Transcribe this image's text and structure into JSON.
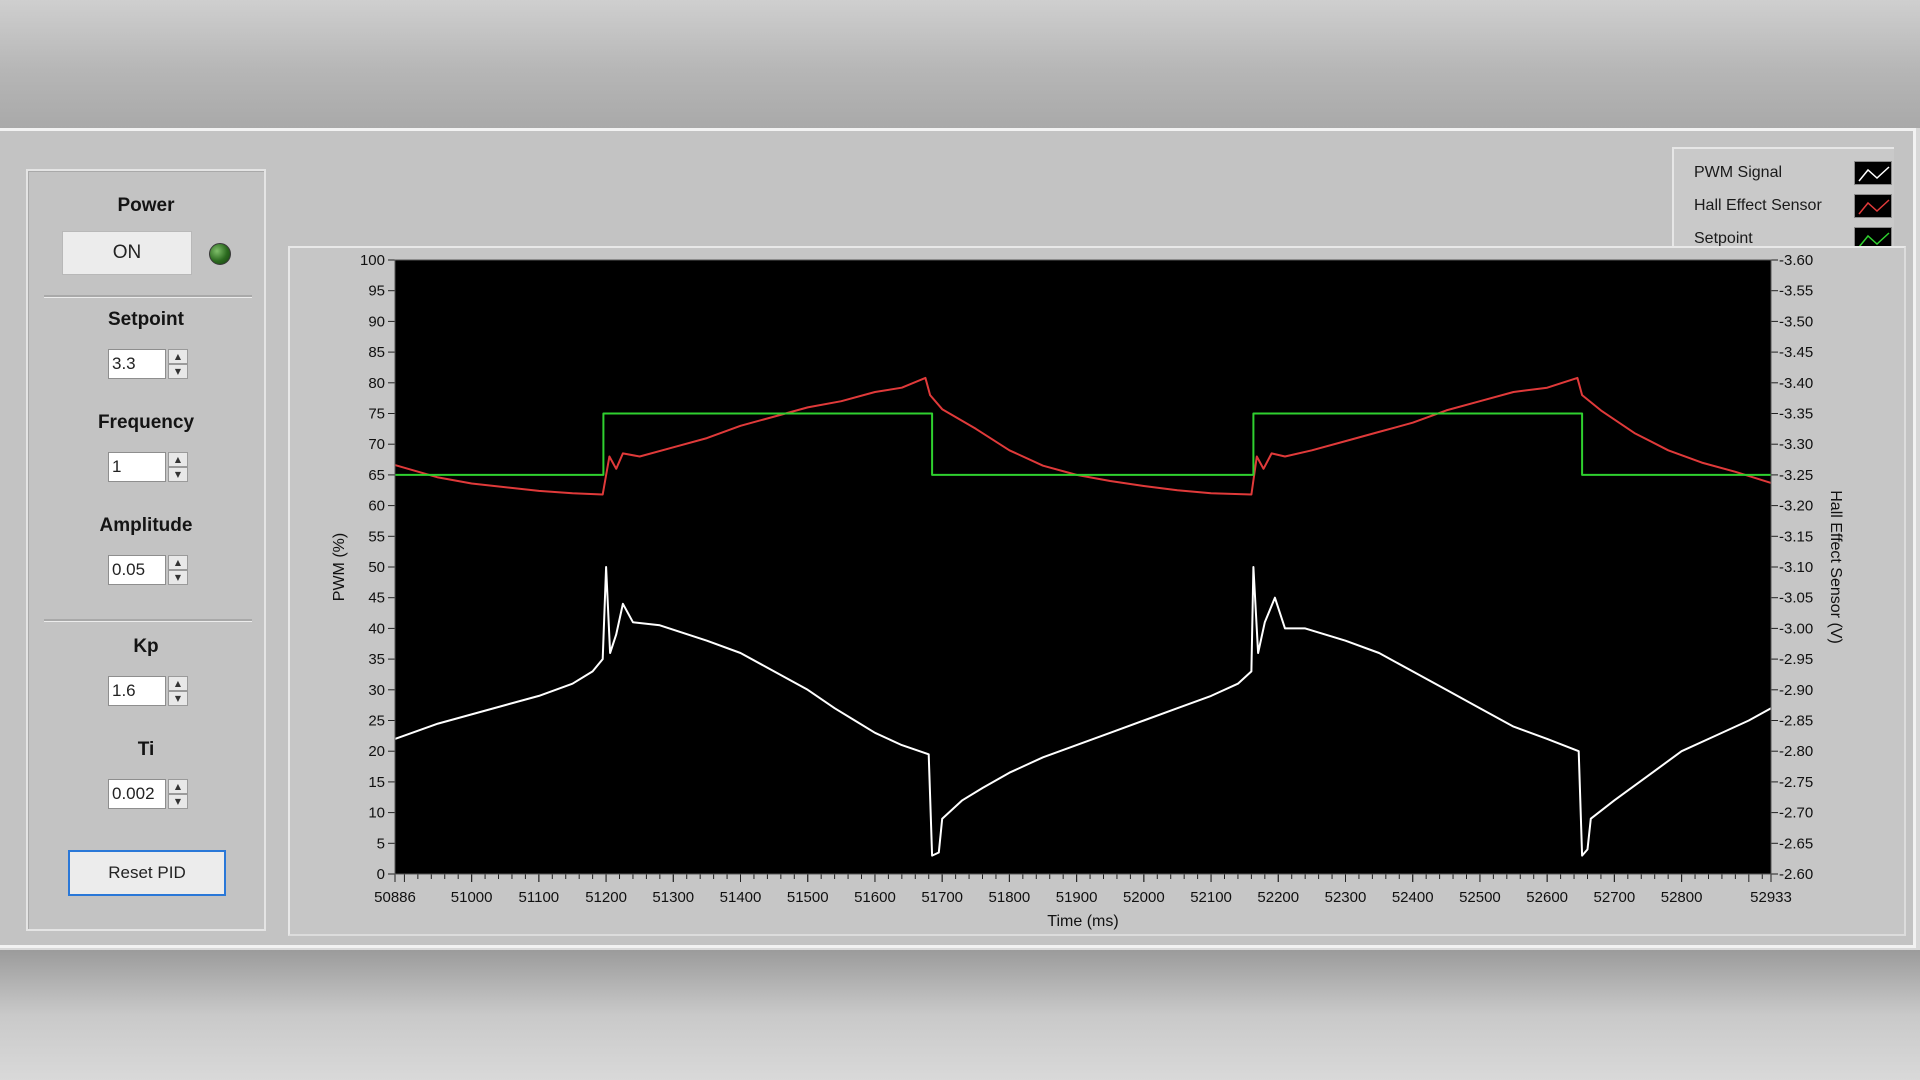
{
  "controls": {
    "power": {
      "label": "Power",
      "button_text": "ON",
      "led_color": "#2e7a23"
    },
    "setpoint": {
      "label": "Setpoint",
      "value": "3.3"
    },
    "frequency": {
      "label": "Frequency",
      "value": "1"
    },
    "amplitude": {
      "label": "Amplitude",
      "value": "0.05"
    },
    "kp": {
      "label": "Kp",
      "value": "1.6"
    },
    "ti": {
      "label": "Ti",
      "value": "0.002"
    },
    "reset_button": "Reset PID",
    "spin_up_icon": "triangle-up-icon",
    "spin_down_icon": "triangle-down-icon"
  },
  "legend": {
    "items": [
      {
        "label": "PWM Signal",
        "color": "#ffffff"
      },
      {
        "label": "Hall Effect Sensor",
        "color": "#e03a3a"
      },
      {
        "label": "Setpoint",
        "color": "#2fd02f"
      }
    ]
  },
  "chart_data": {
    "type": "line",
    "xlabel": "Time (ms)",
    "ylabel": "PWM (%)",
    "y2label": "Hall Effect Sensor (V)",
    "xlim": [
      50886,
      52933
    ],
    "ylim": [
      0,
      100
    ],
    "y2lim": [
      2.6,
      3.6
    ],
    "xticks": [
      "50886",
      "51000",
      "51100",
      "51200",
      "51300",
      "51400",
      "51500",
      "51600",
      "51700",
      "51800",
      "51900",
      "52000",
      "52100",
      "52200",
      "52300",
      "52400",
      "52500",
      "52600",
      "52700",
      "52800",
      "52933"
    ],
    "yticks": [
      "0",
      "5",
      "10",
      "15",
      "20",
      "25",
      "30",
      "35",
      "40",
      "45",
      "50",
      "55",
      "60",
      "65",
      "70",
      "75",
      "80",
      "85",
      "90",
      "95",
      "100"
    ],
    "y2ticks": [
      "2.60",
      "2.65",
      "2.70",
      "2.75",
      "2.80",
      "2.85",
      "2.90",
      "2.95",
      "3.00",
      "3.05",
      "3.10",
      "3.15",
      "3.20",
      "3.25",
      "3.30",
      "3.35",
      "3.40",
      "3.45",
      "3.50",
      "3.55",
      "3.60"
    ],
    "background": "#000000",
    "series": [
      {
        "name": "PWM Signal",
        "axis": "left",
        "color": "#ffffff",
        "points": [
          [
            50886,
            22
          ],
          [
            50950,
            24.5
          ],
          [
            51000,
            26
          ],
          [
            51050,
            27.5
          ],
          [
            51100,
            29
          ],
          [
            51150,
            31
          ],
          [
            51180,
            33
          ],
          [
            51195,
            35
          ],
          [
            51200,
            50
          ],
          [
            51206,
            36
          ],
          [
            51215,
            39
          ],
          [
            51225,
            44
          ],
          [
            51240,
            41
          ],
          [
            51280,
            40.5
          ],
          [
            51350,
            38
          ],
          [
            51400,
            36
          ],
          [
            51450,
            33
          ],
          [
            51500,
            30
          ],
          [
            51540,
            27
          ],
          [
            51570,
            25
          ],
          [
            51600,
            23
          ],
          [
            51640,
            21
          ],
          [
            51680,
            19.5
          ],
          [
            51685,
            3
          ],
          [
            51695,
            3.5
          ],
          [
            51700,
            9
          ],
          [
            51730,
            12
          ],
          [
            51760,
            14
          ],
          [
            51800,
            16.5
          ],
          [
            51850,
            19
          ],
          [
            51900,
            21
          ],
          [
            51950,
            23
          ],
          [
            52000,
            25
          ],
          [
            52050,
            27
          ],
          [
            52100,
            29
          ],
          [
            52140,
            31
          ],
          [
            52160,
            33
          ],
          [
            52163,
            50
          ],
          [
            52170,
            36
          ],
          [
            52180,
            41
          ],
          [
            52195,
            45
          ],
          [
            52210,
            40
          ],
          [
            52240,
            40
          ],
          [
            52300,
            38
          ],
          [
            52350,
            36
          ],
          [
            52400,
            33
          ],
          [
            52450,
            30
          ],
          [
            52500,
            27
          ],
          [
            52550,
            24
          ],
          [
            52600,
            22
          ],
          [
            52647,
            20
          ],
          [
            52652,
            3
          ],
          [
            52660,
            4
          ],
          [
            52665,
            9
          ],
          [
            52700,
            12
          ],
          [
            52750,
            16
          ],
          [
            52800,
            20
          ],
          [
            52850,
            22.5
          ],
          [
            52900,
            25
          ],
          [
            52933,
            27
          ]
        ]
      },
      {
        "name": "Hall Effect Sensor",
        "axis": "right",
        "color": "#e03a3a",
        "points": [
          [
            50886,
            3.266
          ],
          [
            50950,
            3.246
          ],
          [
            51000,
            3.236
          ],
          [
            51100,
            3.224
          ],
          [
            51150,
            3.22
          ],
          [
            51195,
            3.218
          ],
          [
            51205,
            3.28
          ],
          [
            51215,
            3.26
          ],
          [
            51225,
            3.285
          ],
          [
            51250,
            3.28
          ],
          [
            51300,
            3.295
          ],
          [
            51350,
            3.31
          ],
          [
            51400,
            3.33
          ],
          [
            51450,
            3.345
          ],
          [
            51500,
            3.36
          ],
          [
            51550,
            3.37
          ],
          [
            51600,
            3.385
          ],
          [
            51640,
            3.392
          ],
          [
            51675,
            3.408
          ],
          [
            51682,
            3.38
          ],
          [
            51700,
            3.357
          ],
          [
            51750,
            3.325
          ],
          [
            51800,
            3.29
          ],
          [
            51850,
            3.265
          ],
          [
            51900,
            3.25
          ],
          [
            51950,
            3.24
          ],
          [
            52000,
            3.232
          ],
          [
            52050,
            3.225
          ],
          [
            52100,
            3.22
          ],
          [
            52160,
            3.218
          ],
          [
            52168,
            3.28
          ],
          [
            52178,
            3.26
          ],
          [
            52190,
            3.285
          ],
          [
            52210,
            3.28
          ],
          [
            52250,
            3.29
          ],
          [
            52300,
            3.305
          ],
          [
            52350,
            3.32
          ],
          [
            52400,
            3.335
          ],
          [
            52450,
            3.355
          ],
          [
            52500,
            3.37
          ],
          [
            52550,
            3.385
          ],
          [
            52600,
            3.392
          ],
          [
            52645,
            3.408
          ],
          [
            52652,
            3.38
          ],
          [
            52680,
            3.355
          ],
          [
            52730,
            3.318
          ],
          [
            52780,
            3.29
          ],
          [
            52830,
            3.27
          ],
          [
            52880,
            3.255
          ],
          [
            52933,
            3.237
          ]
        ]
      },
      {
        "name": "Setpoint",
        "axis": "right",
        "color": "#2fd02f",
        "points": [
          [
            50886,
            3.25
          ],
          [
            51196,
            3.25
          ],
          [
            51196,
            3.35
          ],
          [
            51685,
            3.35
          ],
          [
            51685,
            3.25
          ],
          [
            52163,
            3.25
          ],
          [
            52163,
            3.35
          ],
          [
            52652,
            3.35
          ],
          [
            52652,
            3.25
          ],
          [
            52933,
            3.25
          ]
        ]
      }
    ]
  }
}
